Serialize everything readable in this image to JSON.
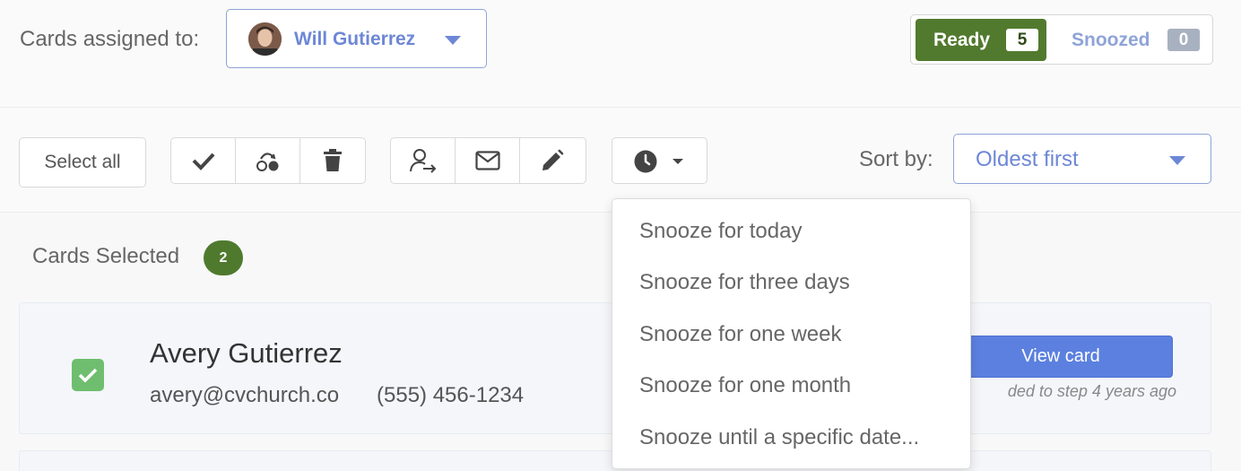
{
  "header": {
    "assigned_label": "Cards assigned to:",
    "assigned_user": "Will Gutierrez",
    "ready_label": "Ready",
    "ready_count": "5",
    "snoozed_label": "Snoozed",
    "snoozed_count": "0"
  },
  "toolbar": {
    "select_all": "Select all",
    "icons": [
      "check-icon",
      "assign-step-icon",
      "trash-icon",
      "transfer-person-icon",
      "mail-icon",
      "pencil-icon",
      "clock-icon"
    ],
    "sort_label": "Sort by:",
    "sort_value": "Oldest first"
  },
  "selection": {
    "label": "Cards Selected",
    "count": "2"
  },
  "card": {
    "name": "Avery Gutierrez",
    "email": "avery@cvchurch.co",
    "phone": "(555) 456-1234",
    "view_label": "View card",
    "meta": "ded to step 4 years ago",
    "checked": true
  },
  "snooze_menu": {
    "items": [
      "Snooze for today",
      "Snooze for three days",
      "Snooze for one week",
      "Snooze for one month",
      "Snooze until a specific date..."
    ]
  },
  "colors": {
    "accent": "#6d87d6",
    "ready_green": "#527a2e",
    "button_blue": "#5b80df",
    "check_green": "#6fbe6f"
  }
}
